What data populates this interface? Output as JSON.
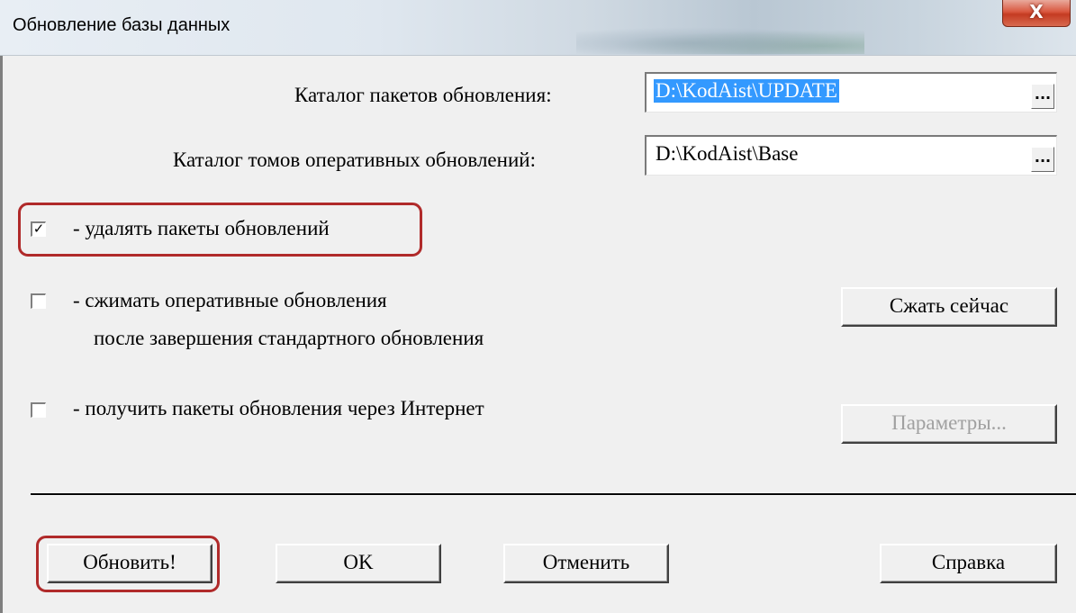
{
  "window": {
    "title": "Обновление базы данных",
    "close_label": "X"
  },
  "fields": {
    "packages_label": "Каталог пакетов обновления:",
    "packages_value": "D:\\KodAist\\UPDATE",
    "volumes_label": "Каталог томов оперативных обновлений:",
    "volumes_value": "D:\\KodAist\\Base",
    "browse_label": "..."
  },
  "options": {
    "delete_packages": {
      "label": "- удалять пакеты обновлений",
      "checked": true
    },
    "compress_updates": {
      "label": "- сжимать оперативные обновления",
      "label_line2": "после завершения стандартного обновления",
      "checked": false
    },
    "internet": {
      "label": "- получить пакеты обновления через Интернет",
      "checked": false
    }
  },
  "buttons": {
    "compress_now": "Сжать сейчас",
    "parameters": "Параметры...",
    "update": "Обновить!",
    "ok": "OK",
    "cancel": "Отменить",
    "help": "Справка"
  },
  "colors": {
    "highlight": "#b02a2a",
    "selection": "#3399ff"
  },
  "checkmark": "✓"
}
